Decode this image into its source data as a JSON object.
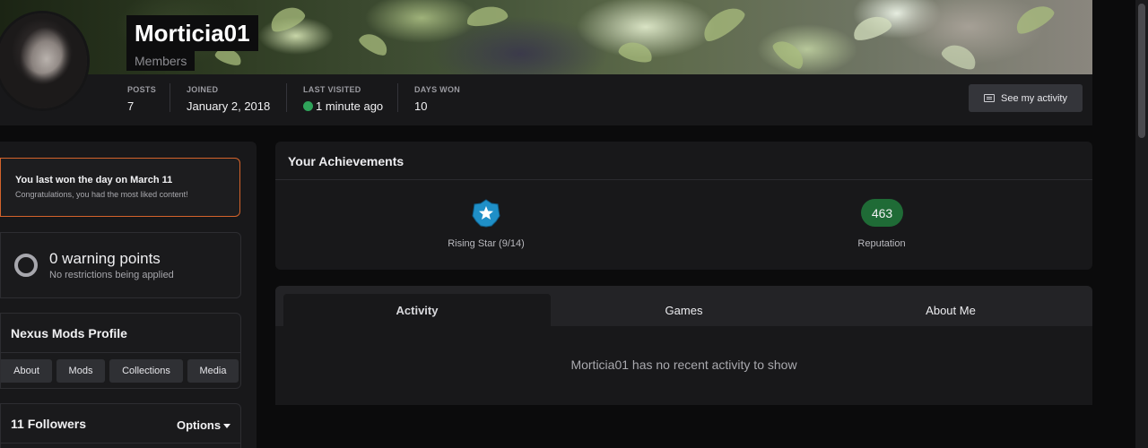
{
  "profile": {
    "name": "Morticia01",
    "group": "Members"
  },
  "stats": {
    "posts": {
      "label": "POSTS",
      "value": "7"
    },
    "joined": {
      "label": "JOINED",
      "value": "January 2, 2018"
    },
    "last_visited": {
      "label": "LAST VISITED",
      "value": "1 minute ago",
      "online": true
    },
    "days_won": {
      "label": "DAYS WON",
      "value": "10"
    }
  },
  "actions": {
    "see_activity": "See my activity"
  },
  "day_won": {
    "title": "You last won the day on March 11",
    "subtitle": "Congratulations, you had the most liked content!"
  },
  "warnings": {
    "title": "0 warning points",
    "subtitle": "No restrictions being applied"
  },
  "nexus": {
    "title": "Nexus Mods Profile",
    "buttons": [
      "About",
      "Mods",
      "Collections",
      "Media"
    ]
  },
  "followers": {
    "title": "11 Followers",
    "options_label": "Options"
  },
  "achievements": {
    "title": "Your Achievements",
    "rank_label": "Rising Star (9/14)",
    "reputation_value": "463",
    "reputation_label": "Reputation"
  },
  "tabs": {
    "items": [
      "Activity",
      "Games",
      "About Me"
    ],
    "active": "Activity",
    "empty_message": "Morticia01 has no recent activity to show"
  },
  "colors": {
    "accent_orange": "#d4632b",
    "online_green": "#2fa35a",
    "reputation_green": "#1f6b36",
    "star_blue": "#1f8fc7"
  },
  "icons": [
    "online-status-icon",
    "activity-icon",
    "warning-ring-icon",
    "rising-star-icon",
    "chevron-down-icon"
  ]
}
